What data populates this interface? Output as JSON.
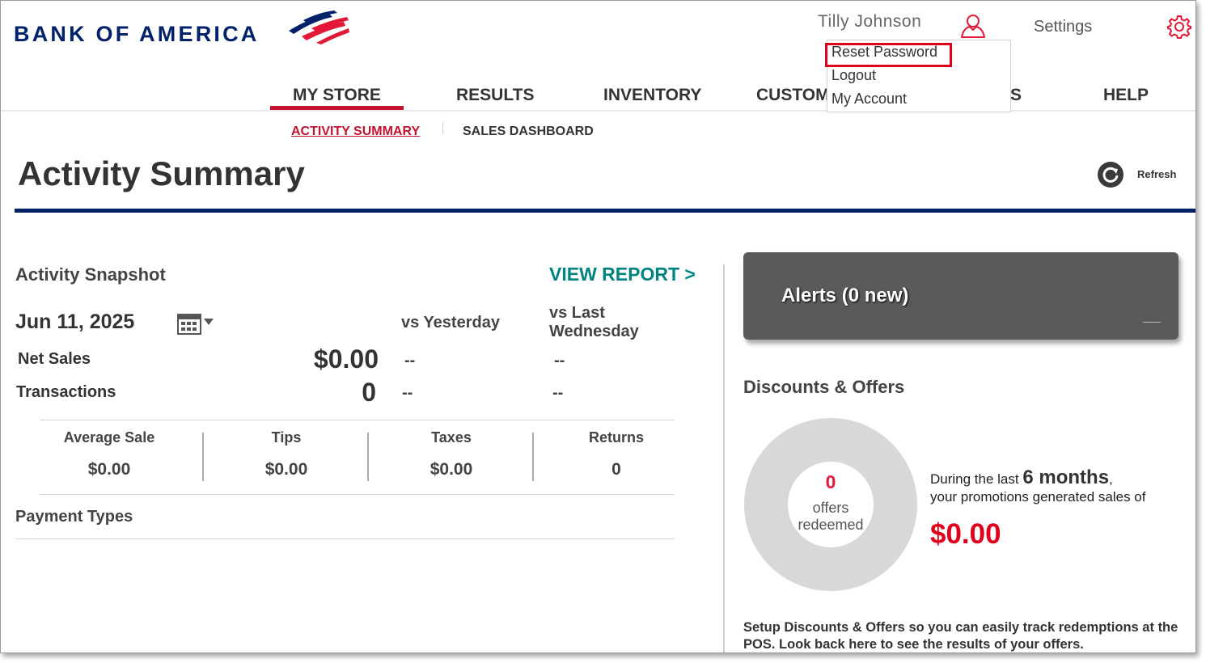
{
  "brand": {
    "name": "BANK OF AMERICA",
    "colors": {
      "navy": "#012169",
      "red": "#e31837"
    }
  },
  "header": {
    "user_name": "Tilly Johnson",
    "user_icon": "user-icon",
    "settings_label": "Settings",
    "settings_icon": "gear-icon"
  },
  "user_menu": {
    "items": [
      "Reset Password",
      "Logout",
      "My Account"
    ],
    "highlighted": "Reset Password"
  },
  "nav": {
    "items": [
      {
        "label": "MY STORE",
        "active": true
      },
      {
        "label": "RESULTS"
      },
      {
        "label": "INVENTORY"
      },
      {
        "label": "CUSTOM"
      },
      {
        "label": "S"
      },
      {
        "label": "HELP"
      }
    ],
    "sub_items": [
      {
        "label": "ACTIVITY SUMMARY",
        "active": true
      },
      {
        "label": "SALES DASHBOARD"
      }
    ]
  },
  "page": {
    "title": "Activity Summary",
    "refresh_label": "Refresh"
  },
  "snapshot": {
    "heading": "Activity Snapshot",
    "view_report": "VIEW REPORT >",
    "date": "Jun 11, 2025",
    "calendar_icon": "calendar-icon",
    "col_vs_yesterday": "vs Yesterday",
    "col_vs_last_1": "vs Last",
    "col_vs_last_2": "Wednesday",
    "rows": [
      {
        "label": "Net Sales",
        "value": "$0.00",
        "vs_yesterday": "--",
        "vs_last": "--"
      },
      {
        "label": "Transactions",
        "value": "0",
        "vs_yesterday": "--",
        "vs_last": "--"
      }
    ],
    "metrics": [
      {
        "label": "Average Sale",
        "value": "$0.00"
      },
      {
        "label": "Tips",
        "value": "$0.00"
      },
      {
        "label": "Taxes",
        "value": "$0.00"
      },
      {
        "label": "Returns",
        "value": "0"
      }
    ],
    "payment_types": "Payment Types"
  },
  "alerts": {
    "title": "Alerts (0 new)"
  },
  "discounts": {
    "heading": "Discounts & Offers",
    "offers_count": "0",
    "offers_label_1": "offers",
    "offers_label_2": "redeemed",
    "promo_prefix": "During the last",
    "promo_period": "6 months",
    "promo_comma": ",",
    "promo_line2": "your promotions generated sales of",
    "promo_amount": "$0.00",
    "setup_text": "Setup Discounts & Offers so you can easily track redemptions at the POS. Look back here to see the results of your offers."
  }
}
